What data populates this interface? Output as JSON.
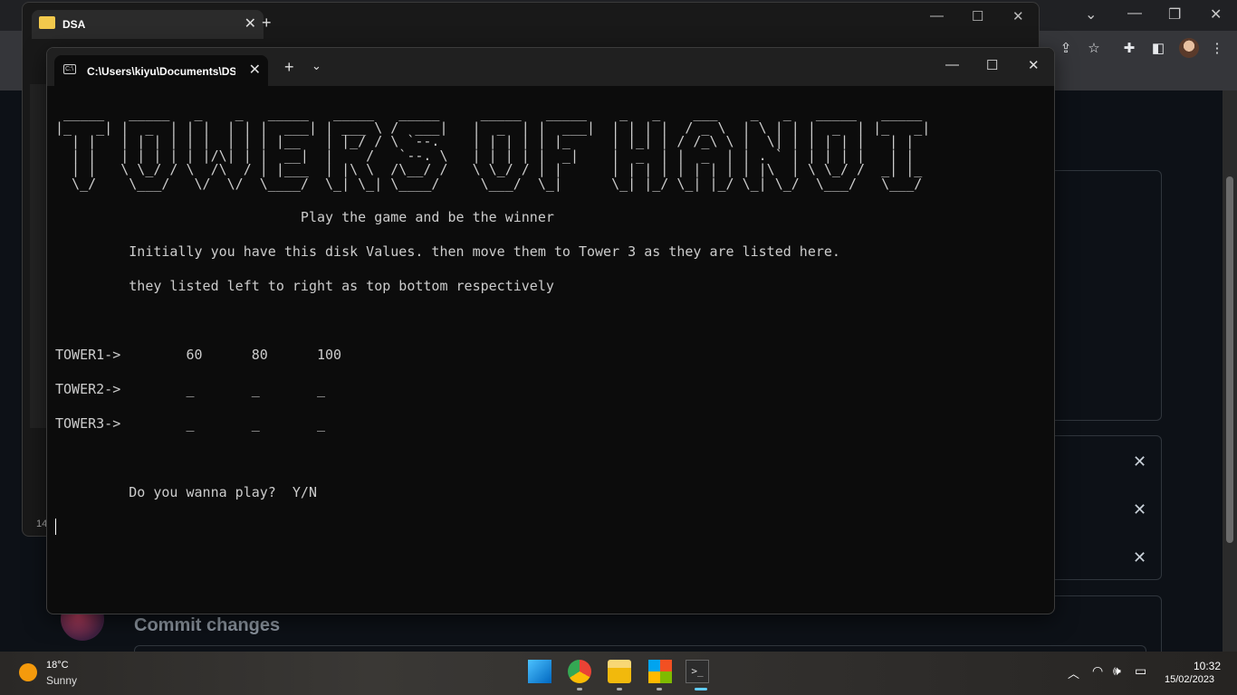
{
  "explorer": {
    "tab_title": "DSA",
    "footer_text": "14"
  },
  "github": {
    "commit_title": "Commit changes"
  },
  "terminal": {
    "tab_title": "C:\\Users\\kiyu\\Documents\\DSA",
    "ascii_title": " _____   _____   _    _   _____   _____   _____     _____   _____    _   _    ___    _   _   _____   _____ \n|_   _| |  _  | | |  | | |  ___| | ___ \\ /  ___|   |  _  | |  ___|  | | | |  / _ \\  | \\ | | |  _  | |_   _|\n  | |   | | | | | |  | | | |__   | |_/ / \\ `--.    | | | | | |_     | |_| | / /_\\ \\ |  \\| | | | | |   | |  \n  | |   | | | | | |/\\| | |  __|  |    /   `--. \\   | | | | |  _|    |  _  | |  _  | | . ` | | | | |   | |  \n  | |   \\ \\_/ / \\  /\\  / | |___  | |\\ \\  /\\__/ /   \\ \\_/ / | |      | | | | | | | | | |\\  | \\ \\_/ /  _| |_ \n  \\_/    \\___/   \\/  \\/  \\____/  \\_| \\_| \\____/     \\___/  \\_|      \\_| |_/ \\_| |_/ \\_| \\_/  \\___/   \\___/ ",
    "subtitle": "                              Play the game and be the winner",
    "intro_line1": "         Initially you have this disk Values. then move them to Tower 3 as they are listed here.",
    "intro_line2": "         they listed left to right as top bottom respectively",
    "tower1": "TOWER1->        60      80      100",
    "tower2": "TOWER2->        _       _       _",
    "tower3": "TOWER3->        _       _       _",
    "prompt": "         Do you wanna play?  Y/N"
  },
  "taskbar": {
    "weather_temp": "18°C",
    "weather_condition": "Sunny",
    "time": "10:32",
    "date": "15/02/2023"
  }
}
